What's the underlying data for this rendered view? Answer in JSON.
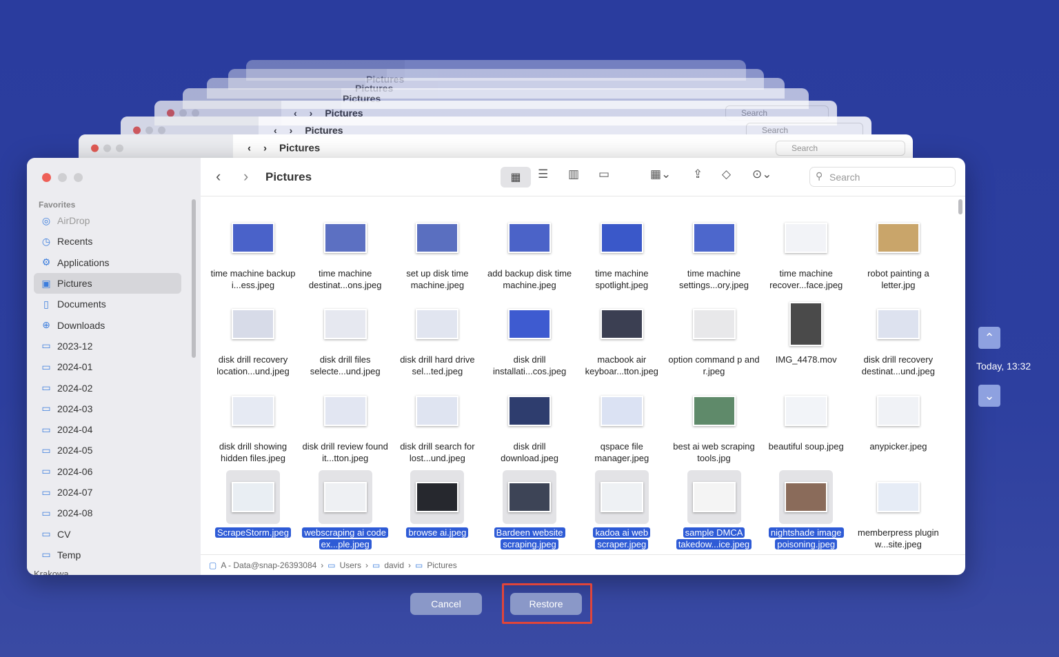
{
  "window": {
    "title": "Pictures",
    "search_placeholder": "Search",
    "sidebar_section": "Favorites",
    "sidebar_items": [
      {
        "label": "AirDrop",
        "icon": "airdrop-icon"
      },
      {
        "label": "Recents",
        "icon": "clock-icon"
      },
      {
        "label": "Applications",
        "icon": "applications-icon"
      },
      {
        "label": "Pictures",
        "icon": "pictures-icon"
      },
      {
        "label": "Documents",
        "icon": "document-icon"
      },
      {
        "label": "Downloads",
        "icon": "download-icon"
      },
      {
        "label": "2023-12",
        "icon": "folder-icon"
      },
      {
        "label": "2024-01",
        "icon": "folder-icon"
      },
      {
        "label": "2024-02",
        "icon": "folder-icon"
      },
      {
        "label": "2024-03",
        "icon": "folder-icon"
      },
      {
        "label": "2024-04",
        "icon": "folder-icon"
      },
      {
        "label": "2024-05",
        "icon": "folder-icon"
      },
      {
        "label": "2024-06",
        "icon": "folder-icon"
      },
      {
        "label": "2024-07",
        "icon": "folder-icon"
      },
      {
        "label": "2024-08",
        "icon": "folder-icon"
      },
      {
        "label": "CV",
        "icon": "folder-icon"
      },
      {
        "label": "Temp",
        "icon": "folder-icon"
      }
    ],
    "sidebar_clipped": "Krakowa",
    "files": [
      {
        "name": "time machine backup i...ess.jpeg"
      },
      {
        "name": "time machine destinat...ons.jpeg"
      },
      {
        "name": "set up disk time machine.jpeg"
      },
      {
        "name": "add backup disk time machine.jpeg"
      },
      {
        "name": "time machine spotlight.jpeg"
      },
      {
        "name": "time machine settings...ory.jpeg"
      },
      {
        "name": "time machine recover...face.jpeg"
      },
      {
        "name": "robot painting a letter.jpg"
      },
      {
        "name": "disk drill recovery location...und.jpeg"
      },
      {
        "name": "disk drill files selecte...und.jpeg"
      },
      {
        "name": "disk drill hard drive sel...ted.jpeg"
      },
      {
        "name": "disk drill installati...cos.jpeg"
      },
      {
        "name": "macbook air keyboar...tton.jpeg"
      },
      {
        "name": "option command p and r.jpeg"
      },
      {
        "name": "IMG_4478.mov"
      },
      {
        "name": "disk drill recovery destinat...und.jpeg"
      },
      {
        "name": "disk drill showing hidden files.jpeg"
      },
      {
        "name": "disk drill review found it...tton.jpeg"
      },
      {
        "name": "disk drill search for lost...und.jpeg"
      },
      {
        "name": "disk drill download.jpeg"
      },
      {
        "name": "qspace file manager.jpeg"
      },
      {
        "name": "best ai web scraping tools.jpg"
      },
      {
        "name": "beautiful soup.jpeg"
      },
      {
        "name": "anypicker.jpeg"
      },
      {
        "name": "ScrapeStorm.jpeg",
        "selected": true
      },
      {
        "name": "webscraping ai code ex...ple.jpeg",
        "selected": true
      },
      {
        "name": "browse ai.jpeg",
        "selected": true
      },
      {
        "name": "Bardeen website scraping.jpeg",
        "selected": true
      },
      {
        "name": "kadoa ai web scraper.jpeg",
        "selected": true
      },
      {
        "name": "sample DMCA takedow...ice.jpeg",
        "selected": true
      },
      {
        "name": "nightshade image poisoning.jpeg",
        "selected": true
      },
      {
        "name": "memberpress plugin w...site.jpeg",
        "selected": false
      }
    ],
    "path": [
      "A - Data@snap-26393084",
      "Users",
      "david",
      "Pictures"
    ]
  },
  "buttons": {
    "cancel": "Cancel",
    "restore": "Restore"
  },
  "timeline": {
    "timestamp": "Today, 13:32"
  },
  "colors": {
    "selection": "#2e5bd6",
    "highlight_box": "#e0453a",
    "background": "#2a3c9e"
  }
}
